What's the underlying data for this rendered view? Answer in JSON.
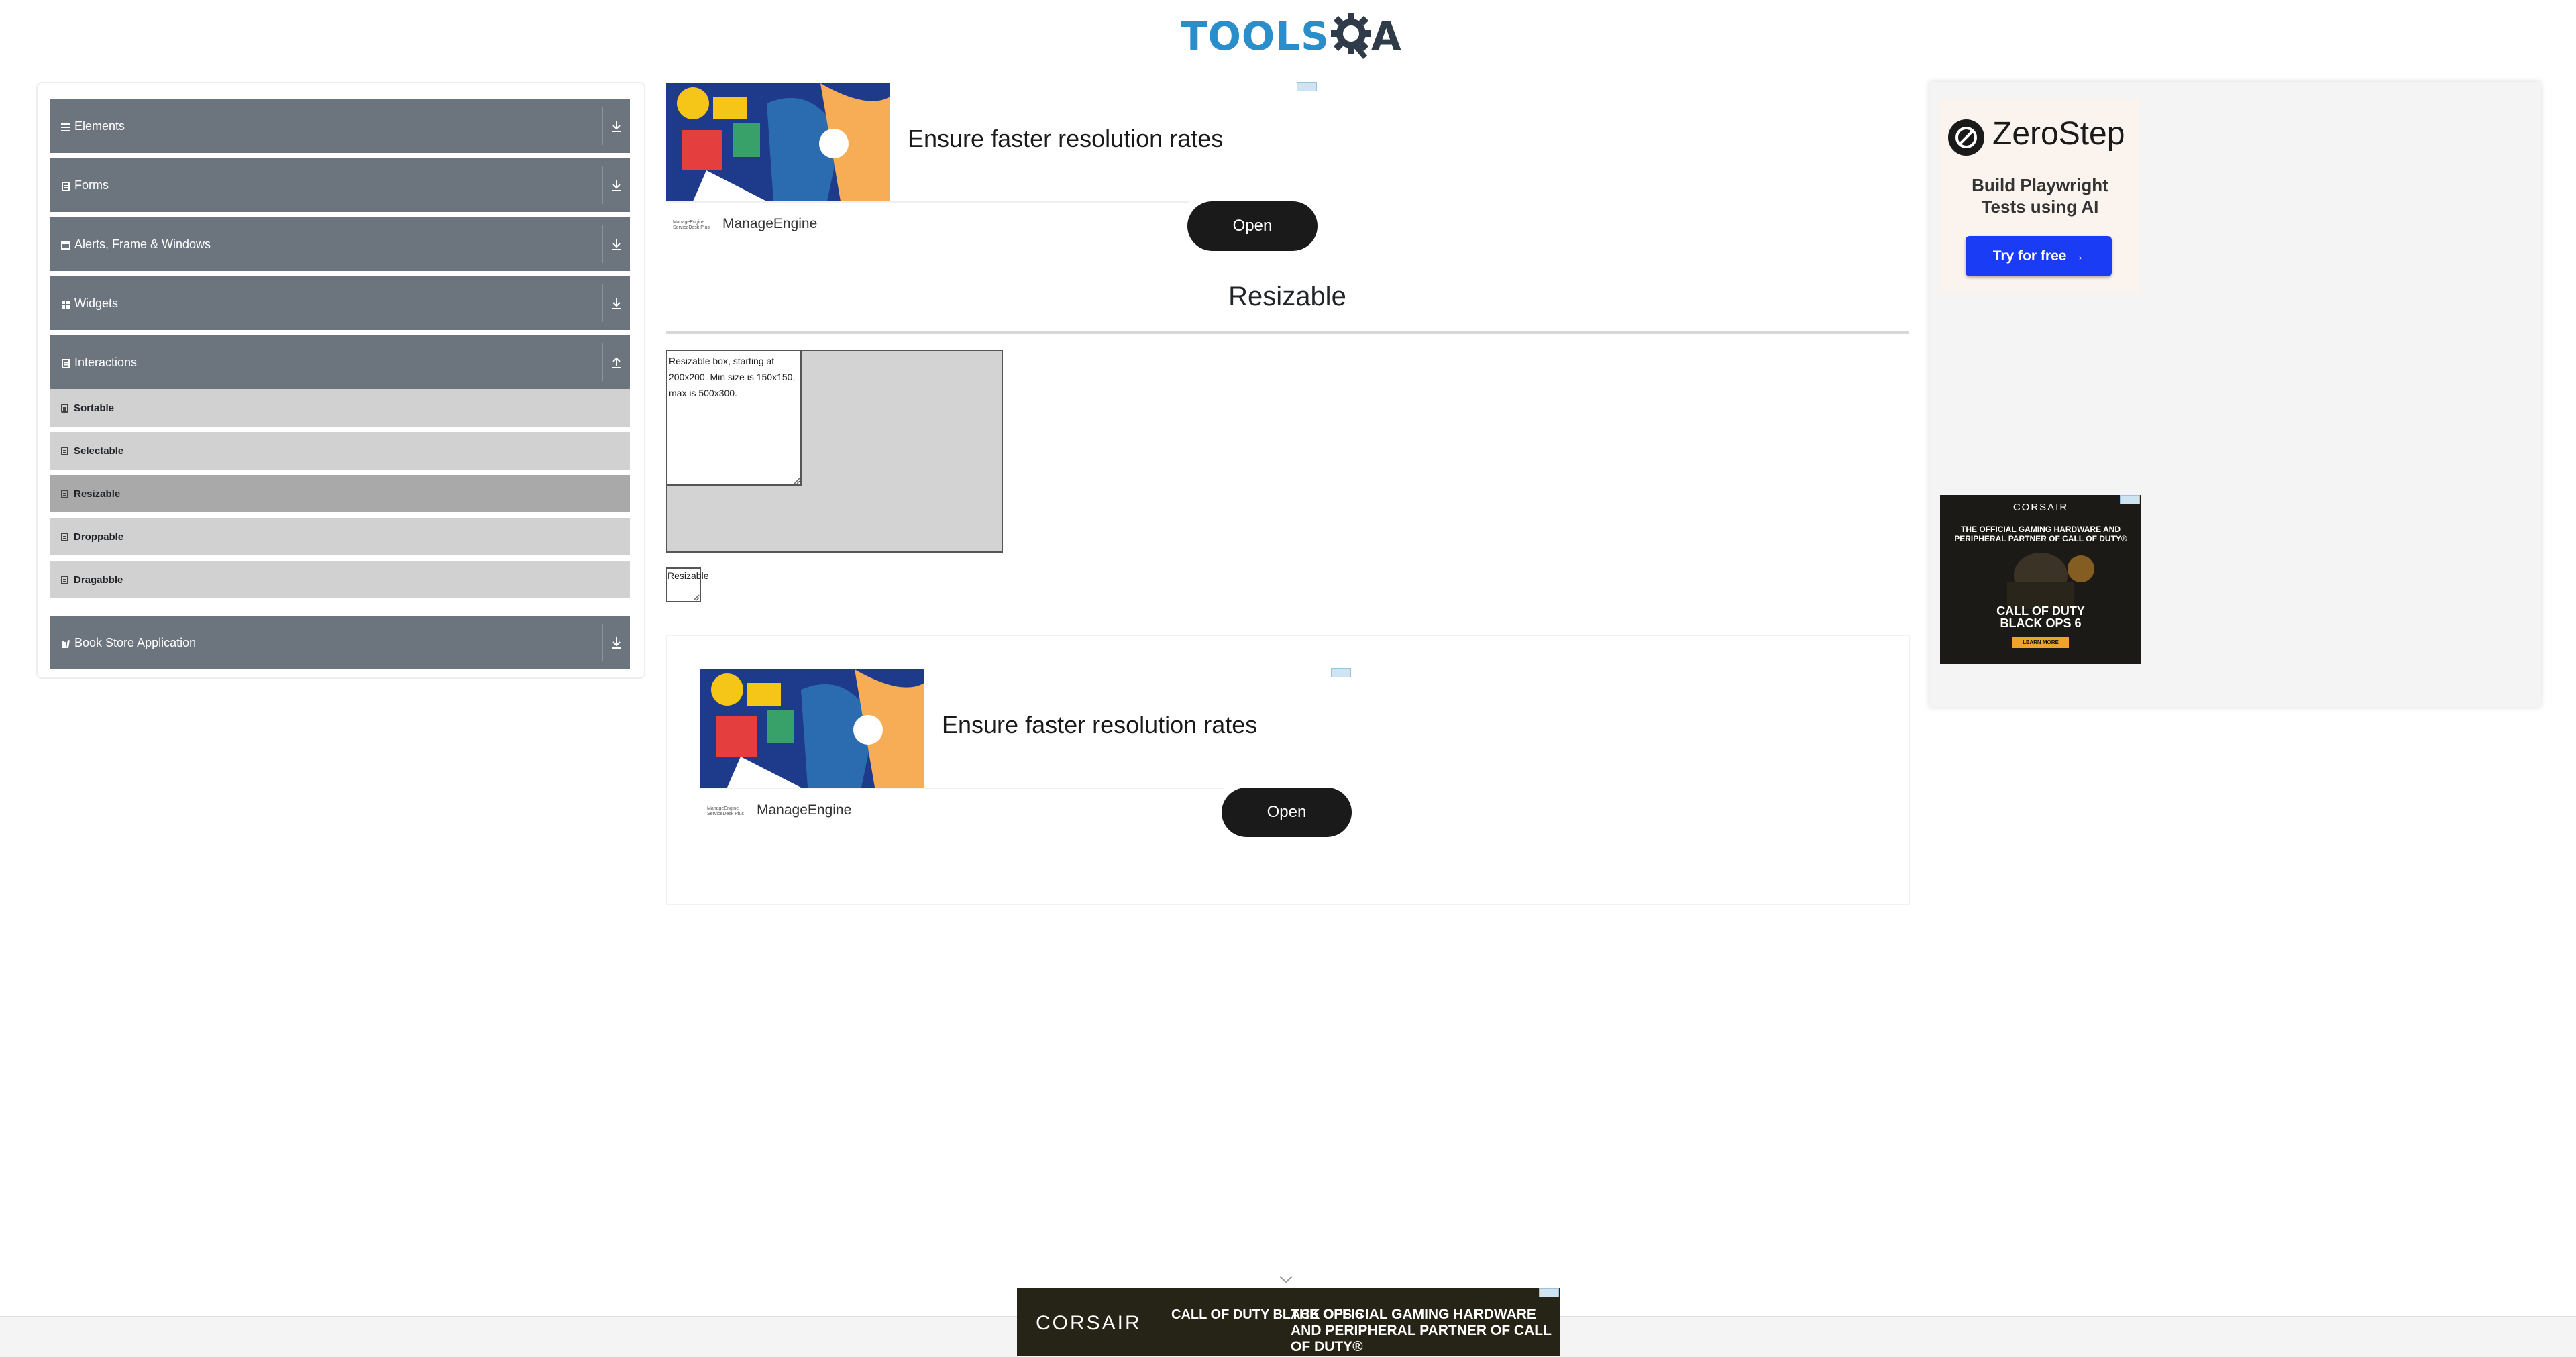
{
  "header": {
    "logo_text": "TOOLS",
    "logo_suffix": "A",
    "brand_color": "#2a8ecb"
  },
  "sidebar": {
    "groups": [
      {
        "label": "Elements",
        "icon": "menu-icon"
      },
      {
        "label": "Forms",
        "icon": "form-icon"
      },
      {
        "label": "Alerts, Frame & Windows",
        "icon": "window-icon"
      },
      {
        "label": "Widgets",
        "icon": "grid-icon"
      },
      {
        "label": "Interactions",
        "icon": "form-icon",
        "expanded": true
      },
      {
        "label": "Book Store Application",
        "icon": "book-icon"
      }
    ],
    "interactions_items": [
      {
        "label": "Sortable"
      },
      {
        "label": "Selectable"
      },
      {
        "label": "Resizable",
        "active": true
      },
      {
        "label": "Droppable"
      },
      {
        "label": "Dragabble"
      }
    ],
    "header_color": "#6c757d"
  },
  "ads": {
    "top": {
      "title": "Ensure faster resolution rates",
      "brand": "ManageEngine",
      "brand_logo_text": "ManageEngine ServiceDesk Plus",
      "button": "Open"
    },
    "bottom": {
      "title": "Ensure faster resolution rates",
      "brand": "ManageEngine",
      "brand_logo_text": "ManageEngine ServiceDesk Plus",
      "button": "Open"
    },
    "zerostep": {
      "name": "ZeroStep",
      "tagline": "Build Playwright Tests using AI",
      "button": "Try for free →"
    },
    "corsair_side": {
      "brand": "CORSAIR",
      "headline": "THE OFFICIAL GAMING HARDWARE AND PERIPHERAL PARTNER OF CALL OF DUTY®",
      "game": "CALL OF DUTY BLACK OPS 6",
      "cta": "LEARN MORE"
    },
    "corsair_banner": {
      "brand": "CORSAIR",
      "game": "CALL OF DUTY BLACK OPS 6",
      "headline": "THE OFFICIAL GAMING HARDWARE AND PERIPHERAL PARTNER OF CALL OF DUTY®"
    }
  },
  "main": {
    "title": "Resizable",
    "restricted_box_text": "Resizable box, starting at 200x200. Min size is 150x150, max is 500x300.",
    "free_box_text": "Resizable"
  }
}
